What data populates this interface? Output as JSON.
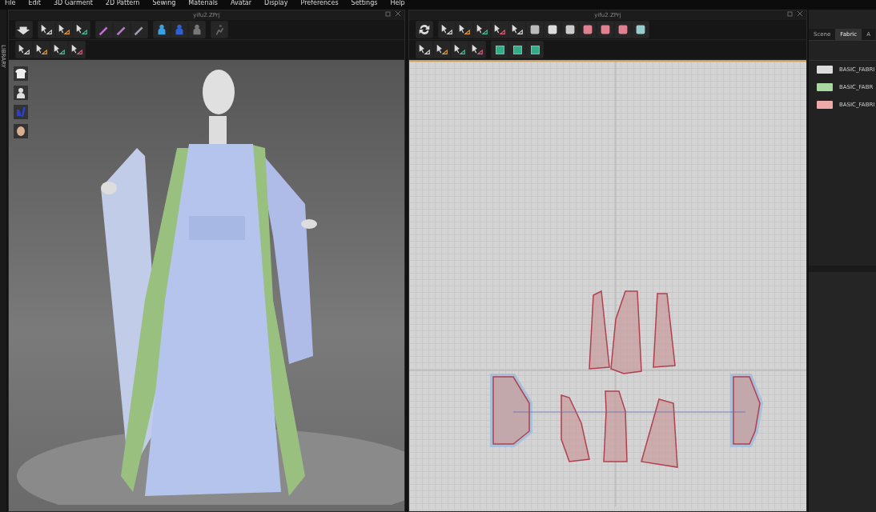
{
  "menu": [
    "File",
    "Edit",
    "3D Garment",
    "2D Pattern",
    "Sewing",
    "Materials",
    "Avatar",
    "Display",
    "Preferences",
    "Settings",
    "Help"
  ],
  "library_tab": {
    "label": "LIBRARY"
  },
  "window_3d": {
    "title": "yifu2.ZPrj"
  },
  "window_2d": {
    "title": "yifu2.ZPrj"
  },
  "side_panel": {
    "tabs": [
      {
        "label": "Scene",
        "selected": false
      },
      {
        "label": "Fabric",
        "selected": true
      },
      {
        "label": "A",
        "selected": false
      }
    ],
    "fabrics": [
      {
        "name": "BASIC_FABRI",
        "color": "#dcdcdc"
      },
      {
        "name": "BASIC_FABR",
        "color": "#a8d8a0"
      },
      {
        "name": "BASIC_FABRI",
        "color": "#eeaaaa"
      }
    ]
  }
}
